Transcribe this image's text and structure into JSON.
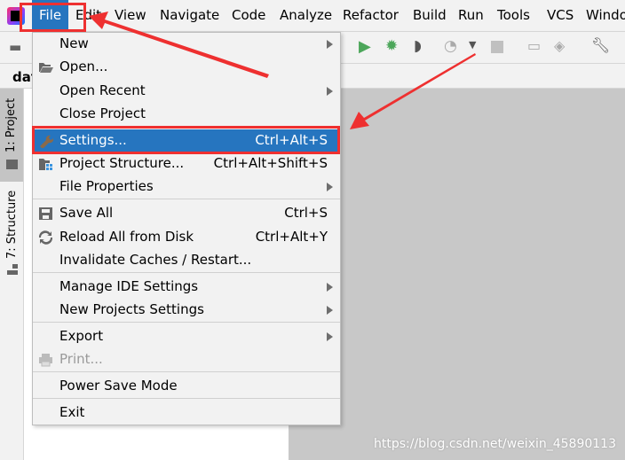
{
  "menubar": {
    "items": [
      "File",
      "Edit",
      "View",
      "Navigate",
      "Code",
      "Analyze",
      "Refactor",
      "Build",
      "Run",
      "Tools",
      "VCS",
      "Windo"
    ]
  },
  "tabrow": {
    "tab": "dat"
  },
  "leftstrip": {
    "project": "1: Project",
    "structure": "7: Structure"
  },
  "file_menu": {
    "items": [
      {
        "label": "New",
        "submenu": true
      },
      {
        "label": "Open...",
        "icon": "folder-open-icon"
      },
      {
        "label": "Open Recent",
        "submenu": true
      },
      {
        "label": "Close Project"
      },
      {
        "label": "Settings...",
        "shortcut": "Ctrl+Alt+S",
        "icon": "wrench-icon",
        "selected": true
      },
      {
        "label": "Project Structure...",
        "shortcut": "Ctrl+Alt+Shift+S",
        "icon": "project-structure-icon"
      },
      {
        "label": "File Properties",
        "submenu": true
      },
      {
        "label": "Save All",
        "shortcut": "Ctrl+S",
        "icon": "save-icon"
      },
      {
        "label": "Reload All from Disk",
        "shortcut": "Ctrl+Alt+Y",
        "icon": "reload-icon"
      },
      {
        "label": "Invalidate Caches / Restart..."
      },
      {
        "label": "Manage IDE Settings",
        "submenu": true
      },
      {
        "label": "New Projects Settings",
        "submenu": true
      },
      {
        "label": "Export",
        "submenu": true
      },
      {
        "label": "Print...",
        "icon": "print-icon",
        "disabled": true
      },
      {
        "label": "Power Save Mode"
      },
      {
        "label": "Exit"
      }
    ]
  },
  "watermark": "https://blog.csdn.net/weixin_45890113",
  "colors": {
    "selection": "#2675bf",
    "annotation": "#ee3030"
  }
}
